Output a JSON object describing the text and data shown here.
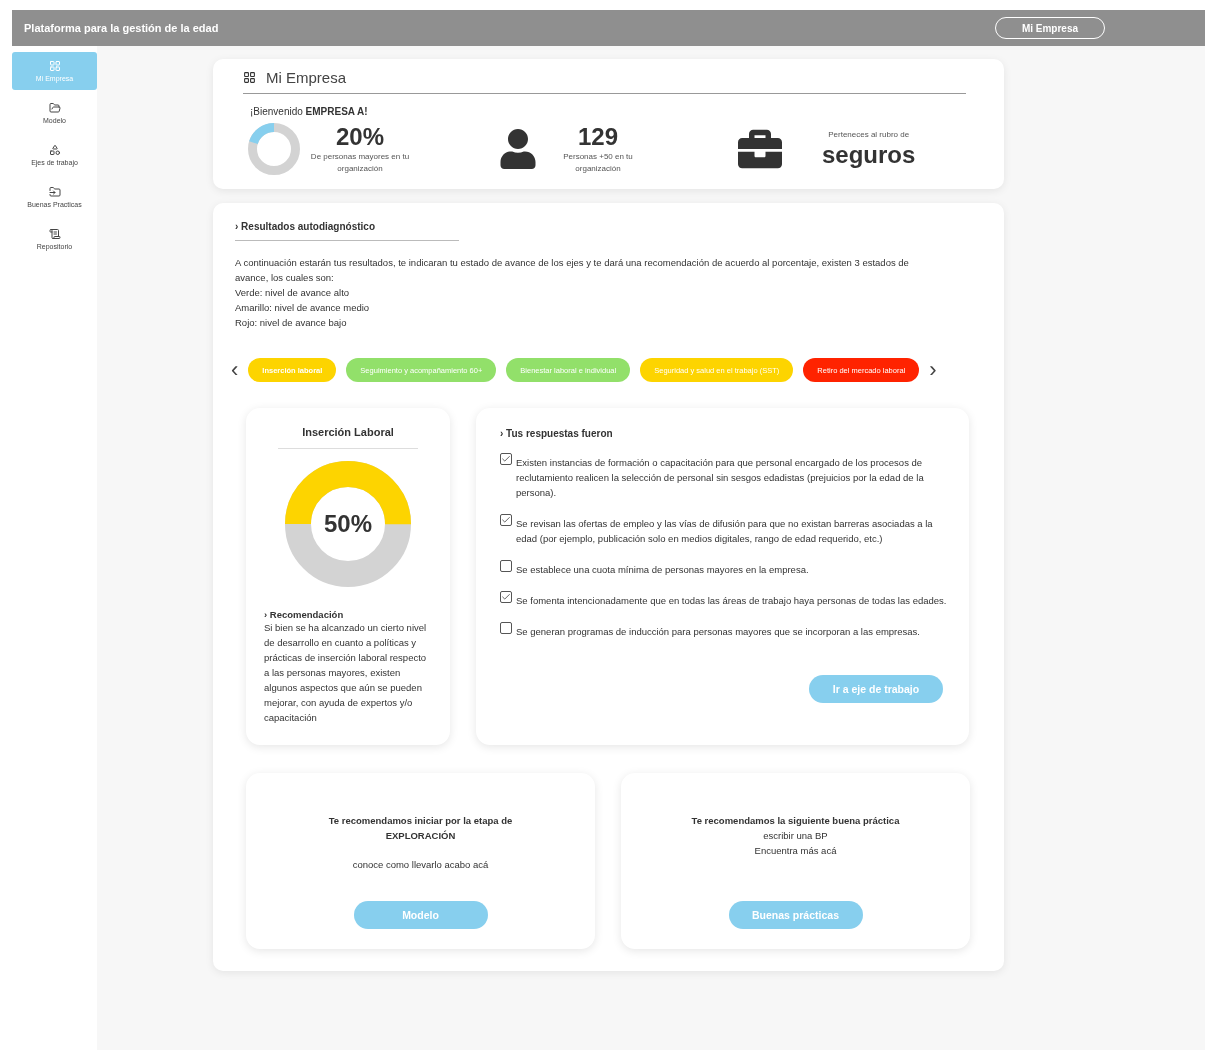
{
  "top_bar": {
    "title": "Plataforma para la gestión de la edad",
    "account_button": "Mi Empresa"
  },
  "sidebar": {
    "items": [
      {
        "label": "Mi Empresa",
        "kind": "grid",
        "selected": true
      },
      {
        "label": "Modelo",
        "kind": "folder",
        "selected": false
      },
      {
        "label": "Ejes de trabajo",
        "kind": "shapes",
        "selected": false
      },
      {
        "label": "Buenas Practicas",
        "kind": "inbox",
        "selected": false
      },
      {
        "label": "Repositorio",
        "kind": "scroll",
        "selected": false
      }
    ]
  },
  "company_card": {
    "title": "Mi Empresa",
    "greeting": "¡Bienvenido **EMPRESA A!**",
    "stats": [
      {
        "kind": "donut",
        "value": "20%",
        "caption": "De personas mayores en tu organización",
        "level": 0.2
      },
      {
        "kind": "person",
        "value": "129",
        "caption": "Personas +50 en tu organización"
      },
      {
        "kind": "briefcase",
        "caption": "Perteneces al rubro de",
        "value": "seguros"
      }
    ]
  },
  "results": {
    "title": "› Resultados autodiagnóstico",
    "intro": [
      "A continuación estarán tus resultados, te indicaran tu estado de avance de los ejes y te dará una recomendación de acuerdo al porcentaje, existen 3 estados de avance, los cuales son:",
      "Verde: nivel de avance alto",
      "Amarillo: nivel de avance medio",
      "Rojo: nivel de avance bajo"
    ],
    "prev_arrow": "‹",
    "next_arrow": "›",
    "tabs": [
      {
        "label": "Inserción laboral",
        "color": "#fdd400",
        "selected": true
      },
      {
        "label": "Seguimiento y acompañamiento 60+",
        "color": "#92e06a",
        "selected": false
      },
      {
        "label": "Bienestar laboral e individual",
        "color": "#92e06a",
        "selected": false
      },
      {
        "label": "Seguridad y salud en el trabajo (SST)",
        "color": "#fdd400",
        "selected": false
      },
      {
        "label": "Retiro del mercado laboral",
        "color": "#ff2300",
        "selected": false
      }
    ],
    "axis_card": {
      "title": "Inserción Laboral",
      "value": "50%",
      "level": 0.5,
      "recommendation_title": "› Recomendación",
      "recommendation": "Si bien se ha alcanzado un cierto nivel de desarrollo en cuanto a políticas y prácticas de inserción laboral respecto a las personas mayores, existen algunos aspectos que aún se pueden mejorar, con ayuda de expertos y/o capacitación"
    },
    "answers": {
      "title": "› Tus respuestas fueron",
      "items": [
        {
          "text": "Existen instancias de formación o capacitación para que personal encargado de los procesos de reclutamiento realicen la selección de personal sin sesgos edadistas (prejuicios por la edad de la persona).",
          "checked": true
        },
        {
          "text": "Se revisan las ofertas de empleo y las vías de difusión para que no existan barreras asociadas a la edad (por ejemplo, publicación solo en medios digitales, rango de edad requerido, etc.)",
          "checked": true
        },
        {
          "text": "Se establece una cuota mínima de personas mayores en la empresa.",
          "checked": false
        },
        {
          "text": "Se fomenta intencionadamente que en todas las áreas de trabajo haya personas de todas las edades.",
          "checked": true
        },
        {
          "text": "Se generan programas de inducción para personas mayores que se incorporan a las empresas.",
          "checked": false
        }
      ],
      "button": "Ir a eje de trabajo"
    },
    "recommendations": [
      {
        "title": "Te recomendamos iniciar por la etapa de EXPLORACIÓN",
        "lines": [
          "conoce como llevarlo acabo acá"
        ],
        "button": "Modelo"
      },
      {
        "title": "Te recomendamos la siguiente buena práctica",
        "lines": [
          "escribir una BP",
          "Encuentra más acá"
        ],
        "button": "Buenas prácticas"
      }
    ]
  }
}
